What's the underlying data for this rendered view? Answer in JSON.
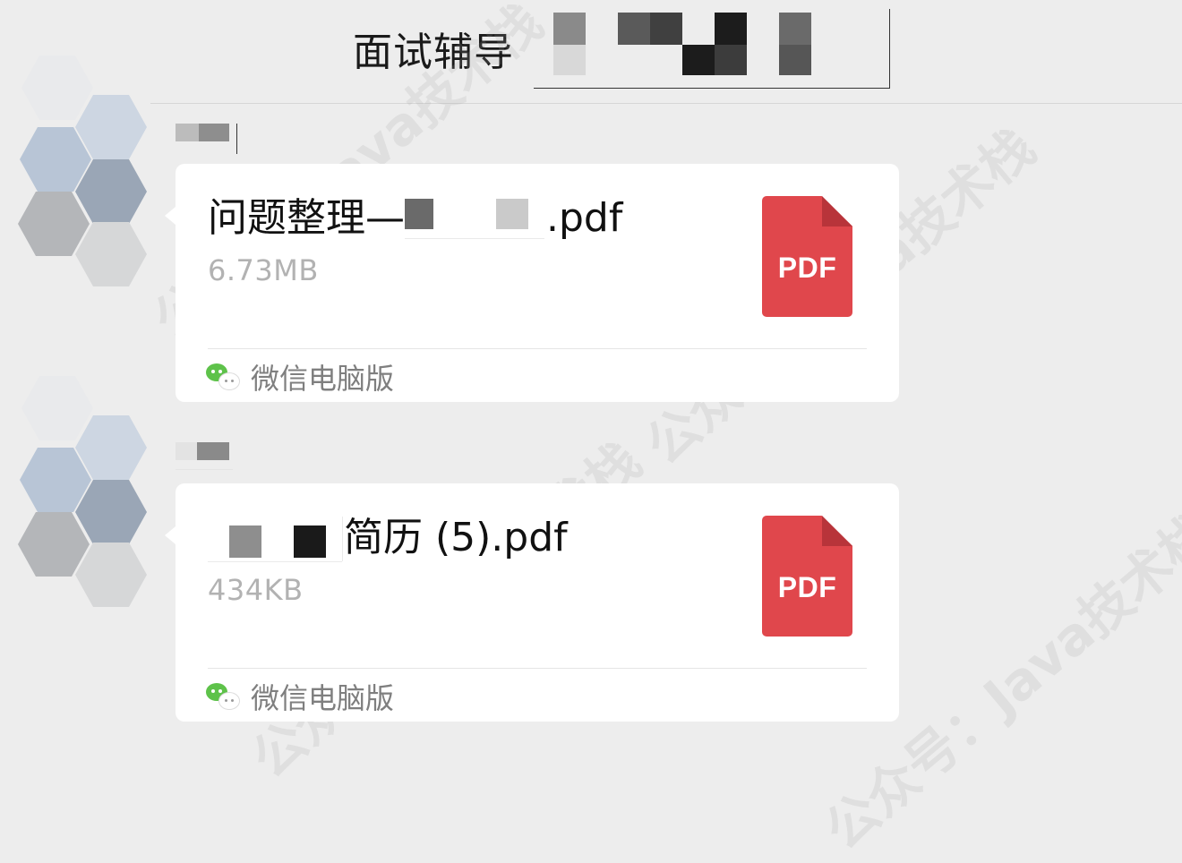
{
  "header": {
    "title": "面试辅导",
    "more_icon": "more-dots-icon"
  },
  "messages": [
    {
      "file_name_prefix": "问题整理—",
      "file_name_suffix": ".pdf",
      "file_size": "6.73MB",
      "file_icon_label": "PDF",
      "source_label": "微信电脑版"
    },
    {
      "file_name_prefix": "",
      "file_name_suffix": "简历 (5).pdf",
      "file_size": "434KB",
      "file_icon_label": "PDF",
      "source_label": "微信电脑版"
    }
  ],
  "watermark": {
    "text": "公众号：Java技术栈"
  },
  "colors": {
    "background": "#ededed",
    "bubble": "#ffffff",
    "pdf_red": "#e0474c",
    "pdf_fold": "#b8343a",
    "wechat_green": "#5ec24a",
    "secondary_text": "#b2b2b2"
  }
}
